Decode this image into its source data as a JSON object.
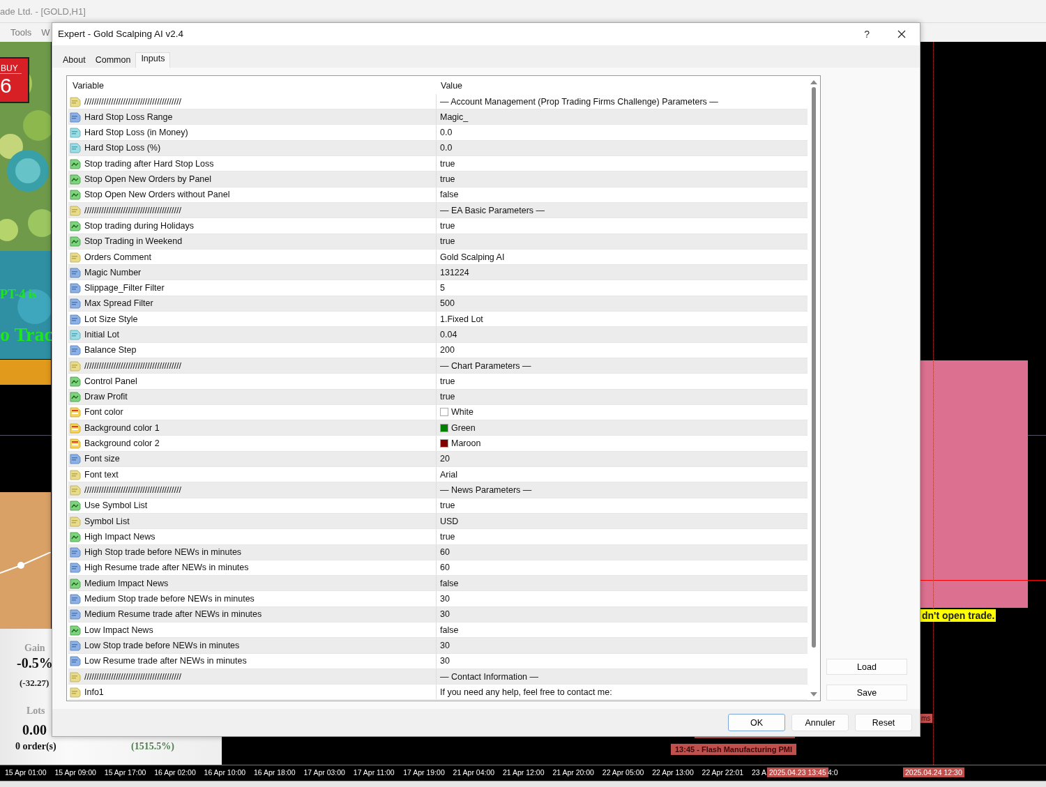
{
  "app_window": {
    "title": "ade Ltd. - [GOLD,H1]",
    "menu": [
      "Tools",
      "W"
    ]
  },
  "chart": {
    "buy_badge": {
      "label": "BUY",
      "value": "6"
    },
    "banner_lines": [
      "PT-4 is",
      "o Trac"
    ],
    "stats": {
      "gain_label": "Gain",
      "gain": "-0.5%",
      "gain_amount": "(-32.27)",
      "lots_label": "Lots",
      "lots": "0.00",
      "orders": "0 order(s)",
      "growth": "(1515.5%)"
    },
    "news_label": "13:45 - Flash Manufacturing PMI",
    "side_label": "ms",
    "warning_label": "dn't open trade.",
    "time_axis": [
      "15 Apr 01:00",
      "15 Apr 09:00",
      "15 Apr 17:00",
      "16 Apr 02:00",
      "16 Apr 10:00",
      "16 Apr 18:00",
      "17 Apr 03:00",
      "17 Apr 11:00",
      "17 Apr 19:00",
      "21 Apr 04:00",
      "21 Apr 12:00",
      "21 Apr 20:00",
      "22 Apr 05:00",
      "22 Apr 13:00",
      "22 Apr 22:01",
      "23 A",
      "4:0"
    ],
    "time_markers": [
      "2025.04.23 13:45",
      "2025.04.24 12:30"
    ]
  },
  "dialog": {
    "title": "Expert - Gold Scalping AI v2.4",
    "help": "?",
    "tabs": [
      {
        "label": "About",
        "selected": false
      },
      {
        "label": "Common",
        "selected": false
      },
      {
        "label": "Inputs",
        "selected": true
      }
    ],
    "columns": [
      "Variable",
      "Value"
    ],
    "rows": [
      {
        "kind": "string",
        "variable": "////////////////////////////////////////",
        "value": "— Account Management (Prop Trading Firms Challenge) Parameters —"
      },
      {
        "kind": "integer",
        "variable": "Hard Stop Loss Range",
        "value": "Magic_"
      },
      {
        "kind": "double",
        "variable": "Hard Stop Loss (in Money)",
        "value": "0.0"
      },
      {
        "kind": "double",
        "variable": "Hard Stop Loss (%)",
        "value": "0.0"
      },
      {
        "kind": "bool",
        "variable": "Stop trading after Hard Stop Loss",
        "value": "true"
      },
      {
        "kind": "bool",
        "variable": "Stop Open New Orders by Panel",
        "value": "true"
      },
      {
        "kind": "bool",
        "variable": "Stop Open New Orders without Panel",
        "value": "false"
      },
      {
        "kind": "string",
        "variable": "////////////////////////////////////////",
        "value": "— EA Basic Parameters —"
      },
      {
        "kind": "bool",
        "variable": "Stop trading during Holidays",
        "value": "true"
      },
      {
        "kind": "bool",
        "variable": "Stop Trading in Weekend",
        "value": "true"
      },
      {
        "kind": "string",
        "variable": "Orders Comment",
        "value": "Gold Scalping AI"
      },
      {
        "kind": "integer",
        "variable": "Magic Number",
        "value": "131224"
      },
      {
        "kind": "integer",
        "variable": "Slippage_Filter Filter",
        "value": "5"
      },
      {
        "kind": "integer",
        "variable": "Max Spread Filter",
        "value": "500"
      },
      {
        "kind": "integer",
        "variable": "Lot Size Style",
        "value": "1.Fixed Lot"
      },
      {
        "kind": "double",
        "variable": "Initial Lot",
        "value": "0.04"
      },
      {
        "kind": "integer",
        "variable": "Balance Step",
        "value": "200"
      },
      {
        "kind": "string",
        "variable": "////////////////////////////////////////",
        "value": "— Chart Parameters —"
      },
      {
        "kind": "bool",
        "variable": "Control Panel",
        "value": "true"
      },
      {
        "kind": "bool",
        "variable": "Draw Profit",
        "value": "true"
      },
      {
        "kind": "color",
        "variable": "Font color",
        "value": "White",
        "color": "#ffffff"
      },
      {
        "kind": "color",
        "variable": "Background color 1",
        "value": "Green",
        "color": "#008000"
      },
      {
        "kind": "color",
        "variable": "Background color 2",
        "value": "Maroon",
        "color": "#800000"
      },
      {
        "kind": "integer",
        "variable": "Font size",
        "value": "20"
      },
      {
        "kind": "string",
        "variable": "Font text",
        "value": "Arial"
      },
      {
        "kind": "string",
        "variable": "////////////////////////////////////////",
        "value": "— News Parameters —"
      },
      {
        "kind": "bool",
        "variable": "Use Symbol List",
        "value": "true"
      },
      {
        "kind": "string",
        "variable": "Symbol List",
        "value": "USD"
      },
      {
        "kind": "bool",
        "variable": "High Impact News",
        "value": "true"
      },
      {
        "kind": "integer",
        "variable": "High Stop trade before NEWs in minutes",
        "value": "60"
      },
      {
        "kind": "integer",
        "variable": "High Resume trade after NEWs in minutes",
        "value": "60"
      },
      {
        "kind": "bool",
        "variable": "Medium Impact News",
        "value": "false"
      },
      {
        "kind": "integer",
        "variable": "Medium Stop trade before NEWs in minutes",
        "value": "30"
      },
      {
        "kind": "integer",
        "variable": "Medium Resume trade after NEWs in minutes",
        "value": "30"
      },
      {
        "kind": "bool",
        "variable": "Low Impact News",
        "value": "false"
      },
      {
        "kind": "integer",
        "variable": "Low Stop trade before NEWs in minutes",
        "value": "30"
      },
      {
        "kind": "integer",
        "variable": "Low Resume trade after NEWs in minutes",
        "value": "30"
      },
      {
        "kind": "string",
        "variable": "////////////////////////////////////////",
        "value": "— Contact Information —"
      },
      {
        "kind": "string",
        "variable": "Info1",
        "value": "If you need any help, feel free to contact me:"
      }
    ],
    "side_buttons": [
      "Load",
      "Save"
    ],
    "buttons": [
      {
        "label": "OK",
        "default": true
      },
      {
        "label": "Annuler",
        "default": false
      },
      {
        "label": "Reset",
        "default": false
      }
    ]
  }
}
